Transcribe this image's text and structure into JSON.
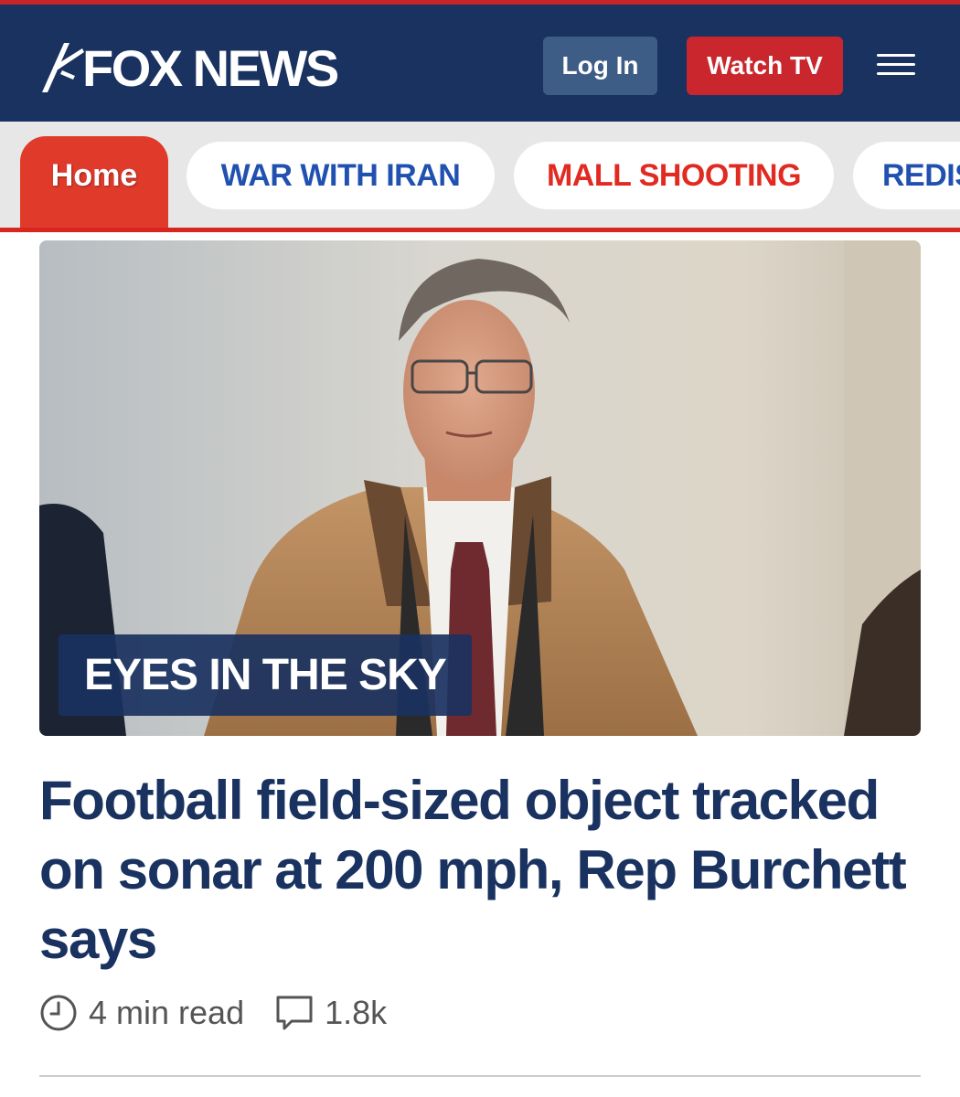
{
  "header": {
    "logo_text": "FOX NEWS",
    "login_label": "Log In",
    "watch_label": "Watch TV",
    "menu_icon": "hamburger-menu-icon",
    "colors": {
      "navy": "#1a3260",
      "red": "#c9272d",
      "login_bg": "#3d5d87"
    }
  },
  "nav": {
    "tabs": [
      {
        "label": "Home",
        "active": true
      },
      {
        "label": "WAR WITH IRAN"
      },
      {
        "label": "MALL SHOOTING"
      },
      {
        "label": "REDIS"
      }
    ]
  },
  "article": {
    "kicker": "EYES IN THE SKY",
    "headline": "Football field-sized object tracked on sonar at 200 mph, Rep Burchett says",
    "read_time": "4 min read",
    "comment_count": "1.8k",
    "icons": [
      "clock-icon",
      "comment-icon"
    ]
  }
}
